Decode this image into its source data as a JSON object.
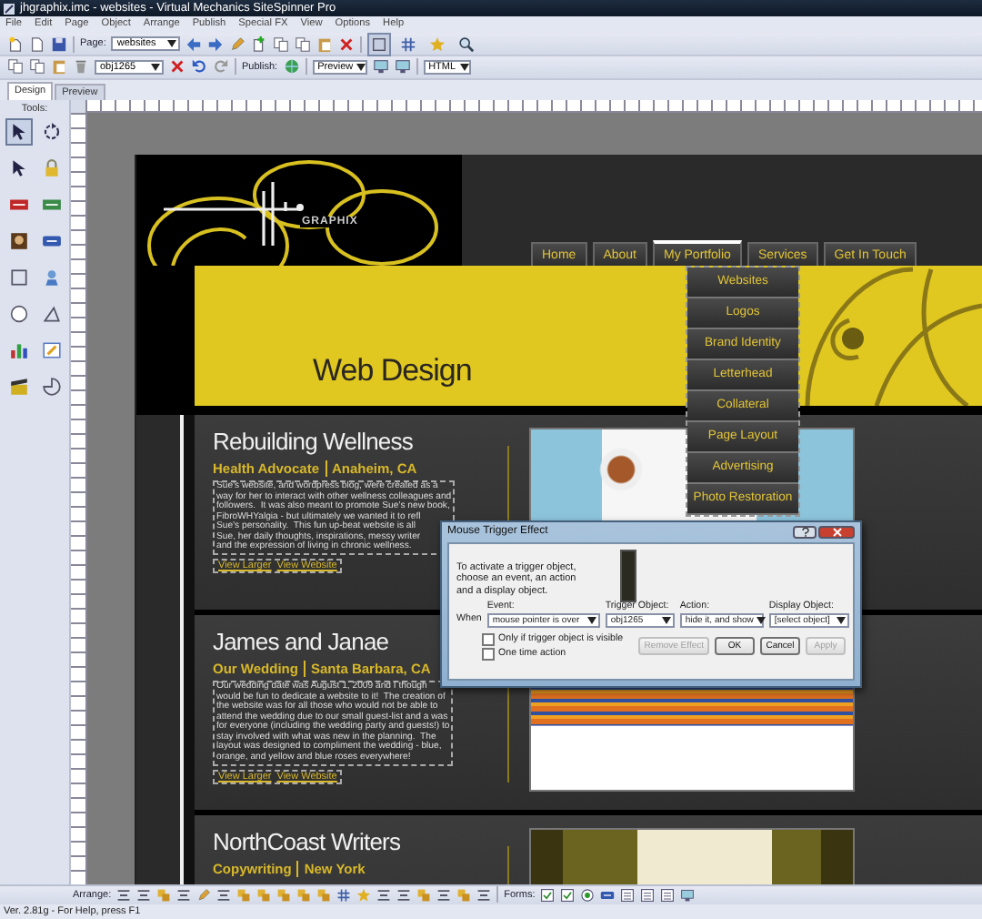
{
  "window": {
    "title": "jhgraphix.imc - websites - Virtual Mechanics SiteSpinner Pro"
  },
  "menu_bar": [
    "File",
    "Edit",
    "Page",
    "Object",
    "Arrange",
    "Publish",
    "Special FX",
    "View",
    "Options",
    "Help"
  ],
  "toolbar": {
    "page_label": "Page:",
    "page_value": "websites",
    "object_value": "obj1265",
    "publish_label": "Publish:",
    "preview_value": "Preview",
    "format_value": "HTML",
    "modes": [
      {
        "selected": true
      },
      {
        "selected": false
      },
      {
        "selected": false
      },
      {
        "selected": false
      }
    ]
  },
  "view_tabs": [
    {
      "label": "Design",
      "selected": true
    },
    {
      "label": "Preview",
      "selected": false
    }
  ],
  "tools_panel": {
    "title": "Tools:",
    "tools": [
      {
        "selected": true
      },
      {
        "selected": false
      },
      {
        "selected": false
      },
      {
        "selected": false
      },
      {
        "selected": false
      },
      {
        "selected": false
      },
      {
        "selected": false
      },
      {
        "selected": false
      },
      {
        "selected": false
      },
      {
        "selected": false
      },
      {
        "selected": false
      },
      {
        "selected": false
      },
      {
        "selected": false
      },
      {
        "selected": false
      },
      {
        "selected": false
      },
      {
        "selected": false
      }
    ]
  },
  "site": {
    "logo_text": "GRAPHIX",
    "nav": [
      {
        "label": "Home",
        "selected": false
      },
      {
        "label": "About",
        "selected": false
      },
      {
        "label": "My Portfolio",
        "selected": true
      },
      {
        "label": "Services",
        "selected": false
      },
      {
        "label": "Get In Touch",
        "selected": false
      }
    ],
    "submenu": [
      "Websites",
      "Logos",
      "Brand Identity",
      "Letterhead",
      "Collateral",
      "Page Layout",
      "Advertising",
      "Photo Restoration"
    ],
    "banner_title": "Web Design",
    "projects": [
      {
        "kind": "tea",
        "title": "Rebuilding Wellness",
        "role": "Health Advocate",
        "place": "Anaheim, CA",
        "description": "Sue's website, and wordpress blog, were created as a\nway for her to interact with other wellness colleagues and\nfollowers.  It was also meant to promote Sue's new book,\nFibroWHYalgia - but ultimately we wanted it to refl\nSue's personality.  This fun up-beat website is all\nSue, her daily thoughts, inspirations, messy writer\nand the expression of living in chronic wellness.",
        "links": [
          "View Larger",
          "View Website"
        ]
      },
      {
        "kind": "wedding",
        "title": "James and Janae",
        "role": "Our Wedding",
        "place": "Santa Barbara, CA",
        "description": "Our wedding date was August 1, 2009 and I though\nwould be fun to dedicate a website to it!  The creation of\nthe website was for all those who would not be able to\nattend the wedding due to our small guest-list and a was\nfor everyone (including the wedding party and guests!) to\nstay involved with what was new in the planning.  The\nlayout was designed to compliment the wedding - blue,\norange, and yellow and blue roses everywhere!",
        "links": [
          "View Larger",
          "View Website"
        ]
      },
      {
        "kind": "forest",
        "title": "NorthCoast Writers",
        "role": "Copywriting",
        "place": "New York"
      }
    ]
  },
  "dialog": {
    "title": "Mouse Trigger Effect",
    "intro": "To activate a trigger object, choose an event, an action and a display object.",
    "when_label": "When",
    "fields": [
      {
        "label": "Event:",
        "value": "mouse pointer is over"
      },
      {
        "label": "Trigger Object:",
        "value": "obj1265"
      },
      {
        "label": "Action:",
        "value": "hide it, and show"
      },
      {
        "label": "Display Object:",
        "value": "[select object]"
      }
    ],
    "checkboxes": [
      {
        "label": "Only if trigger object is visible",
        "checked": false
      },
      {
        "label": "One time action",
        "checked": false
      }
    ],
    "buttons": [
      {
        "label": "Remove Effect",
        "disabled": true
      },
      {
        "label": "OK",
        "disabled": false
      },
      {
        "label": "Cancel",
        "disabled": false
      },
      {
        "label": "Apply",
        "disabled": true
      }
    ]
  },
  "bottom_toolbar": {
    "arrange_label": "Arrange:",
    "forms_label": "Forms:"
  },
  "status_bar": "Ver. 2.81g - For Help, press F1"
}
